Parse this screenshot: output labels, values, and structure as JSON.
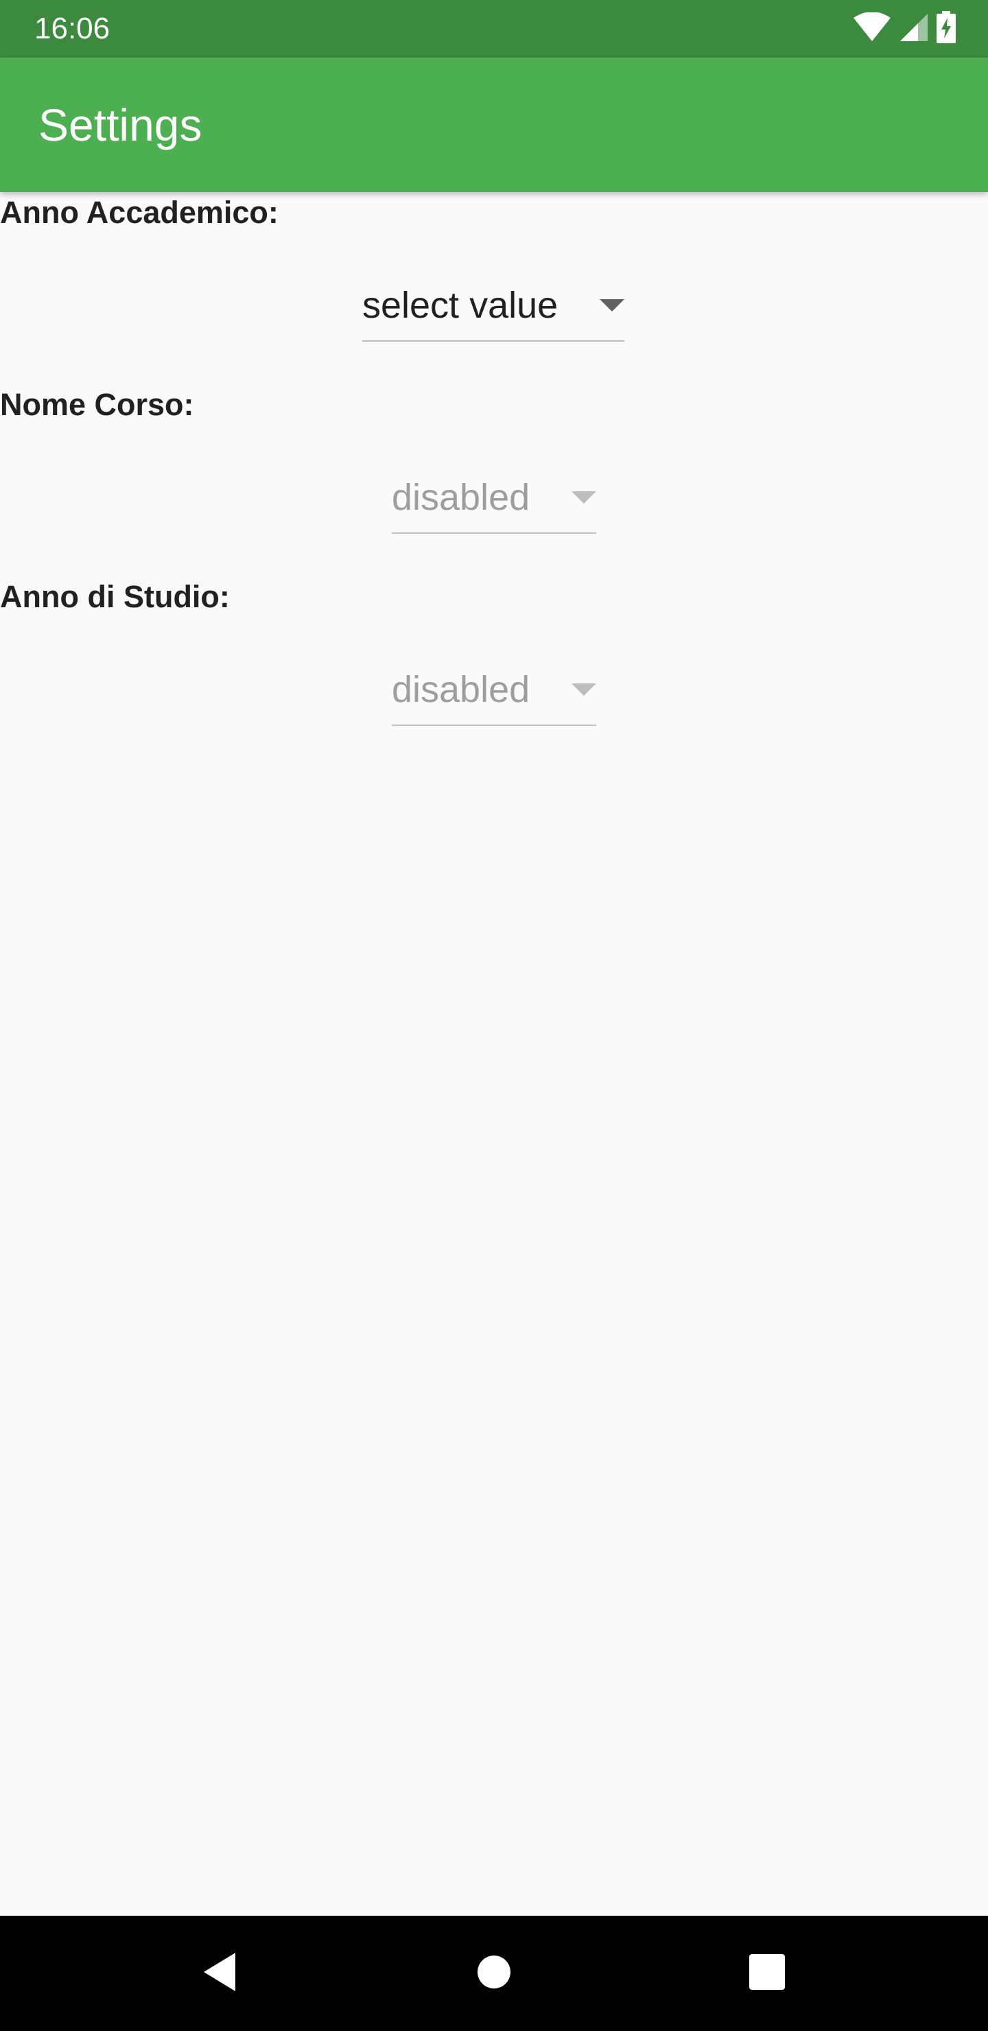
{
  "status_bar": {
    "time": "16:06",
    "icons": [
      "wifi-icon",
      "signal-icon",
      "battery-charging-icon"
    ]
  },
  "app_bar": {
    "title": "Settings",
    "color": "#4caf50",
    "status_color": "#3b8a3e"
  },
  "fields": [
    {
      "label": "Anno Accademico:",
      "value": "select value",
      "enabled": true
    },
    {
      "label": "Nome Corso:",
      "value": "disabled",
      "enabled": false
    },
    {
      "label": "Anno di Studio:",
      "value": "disabled",
      "enabled": false
    }
  ],
  "nav_bar": {
    "buttons": [
      "back-icon",
      "home-icon",
      "recents-icon"
    ]
  }
}
